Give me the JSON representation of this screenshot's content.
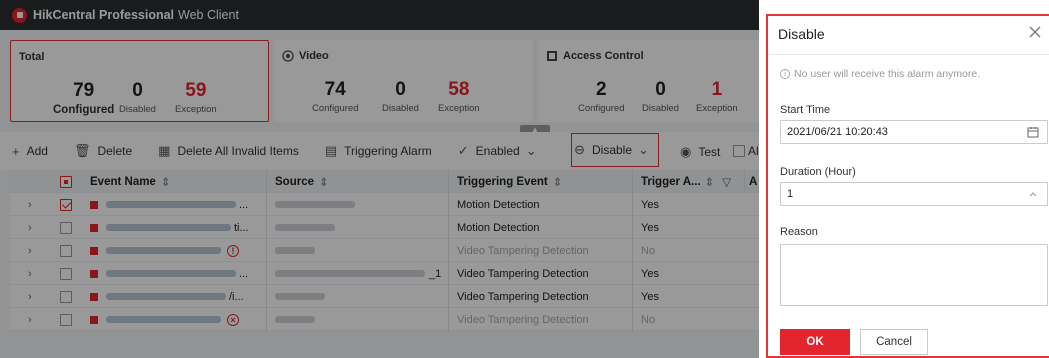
{
  "app": {
    "brand": "HikCentral Professional",
    "brand_suffix": "Web Client"
  },
  "summary": {
    "total": {
      "title": "Total",
      "configured": "79",
      "configured_label": "Configured",
      "disabled": "0",
      "disabled_label": "Disabled",
      "exception": "59",
      "exception_label": "Exception"
    },
    "video": {
      "title": "Video",
      "configured": "74",
      "configured_label": "Configured",
      "disabled": "0",
      "disabled_label": "Disabled",
      "exception": "58",
      "exception_label": "Exception"
    },
    "access": {
      "title": "Access Control",
      "configured": "2",
      "configured_label": "Configured",
      "disabled": "0",
      "disabled_label": "Disabled",
      "exception": "1",
      "exception_label": "Exception"
    }
  },
  "toolbar": {
    "add": "Add",
    "delete": "Delete",
    "delete_invalid": "Delete All Invalid Items",
    "triggering_alarm": "Triggering Alarm",
    "enabled": "Enabled",
    "disable": "Disable",
    "test": "Test",
    "all": "Al"
  },
  "table": {
    "headers": {
      "event_name": "Event Name",
      "source": "Source",
      "triggering_event": "Triggering Event",
      "trigger_a": "Trigger A...",
      "more": "A"
    },
    "rows": [
      {
        "name_tail": "...",
        "source_tail": "",
        "event": "Motion Detection",
        "trigger": "Yes",
        "checked": true
      },
      {
        "name_tail": "ti...",
        "source_tail": "",
        "event": "Motion Detection",
        "trigger": "Yes",
        "checked": false
      },
      {
        "name_tail": "",
        "source_tail": "",
        "event": "Video Tampering Detection",
        "trigger": "No",
        "checked": false
      },
      {
        "name_tail": "...",
        "source_tail": "_1",
        "event": "Video Tampering Detection",
        "trigger": "Yes",
        "checked": false
      },
      {
        "name_tail": "/i...",
        "source_tail": "",
        "event": "Video Tampering Detection",
        "trigger": "Yes",
        "checked": false
      },
      {
        "name_tail": "",
        "source_tail": "",
        "event": "Video Tampering Detection",
        "trigger": "No",
        "checked": false
      }
    ]
  },
  "dialog": {
    "title": "Disable",
    "hint": "No user will receive this alarm anymore.",
    "start_time_label": "Start Time",
    "start_time_value": "2021/06/21 10:20:43",
    "duration_label": "Duration (Hour)",
    "duration_value": "1",
    "reason_label": "Reason",
    "ok": "OK",
    "cancel": "Cancel"
  },
  "colors": {
    "accent": "#e3262e",
    "topbar": "#2b2d30"
  }
}
